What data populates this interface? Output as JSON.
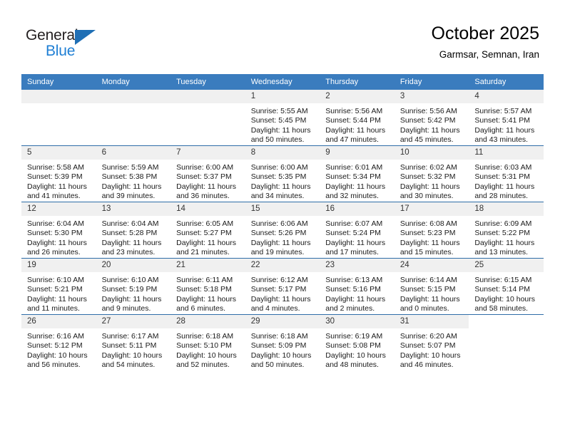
{
  "brand": {
    "name_top": "General",
    "name_bottom": "Blue",
    "triangle_icon": "triangle-icon",
    "color_dark": "#231f20",
    "color_blue": "#1f7fd4"
  },
  "header": {
    "title": "October 2025",
    "subtitle": "Garmsar, Semnan, Iran"
  },
  "colors": {
    "header_band": "#3a7cbe",
    "row_separator": "#2f6da8",
    "daynum_strip": "#f0f0f0",
    "text": "#1a1a1a"
  },
  "weekdays": [
    "Sunday",
    "Monday",
    "Tuesday",
    "Wednesday",
    "Thursday",
    "Friday",
    "Saturday"
  ],
  "weeks": [
    [
      {
        "day": "",
        "empty": true
      },
      {
        "day": "",
        "empty": true
      },
      {
        "day": "",
        "empty": true
      },
      {
        "day": "1",
        "sunrise": "Sunrise: 5:55 AM",
        "sunset": "Sunset: 5:45 PM",
        "daylight1": "Daylight: 11 hours",
        "daylight2": "and 50 minutes."
      },
      {
        "day": "2",
        "sunrise": "Sunrise: 5:56 AM",
        "sunset": "Sunset: 5:44 PM",
        "daylight1": "Daylight: 11 hours",
        "daylight2": "and 47 minutes."
      },
      {
        "day": "3",
        "sunrise": "Sunrise: 5:56 AM",
        "sunset": "Sunset: 5:42 PM",
        "daylight1": "Daylight: 11 hours",
        "daylight2": "and 45 minutes."
      },
      {
        "day": "4",
        "sunrise": "Sunrise: 5:57 AM",
        "sunset": "Sunset: 5:41 PM",
        "daylight1": "Daylight: 11 hours",
        "daylight2": "and 43 minutes."
      }
    ],
    [
      {
        "day": "5",
        "sunrise": "Sunrise: 5:58 AM",
        "sunset": "Sunset: 5:39 PM",
        "daylight1": "Daylight: 11 hours",
        "daylight2": "and 41 minutes."
      },
      {
        "day": "6",
        "sunrise": "Sunrise: 5:59 AM",
        "sunset": "Sunset: 5:38 PM",
        "daylight1": "Daylight: 11 hours",
        "daylight2": "and 39 minutes."
      },
      {
        "day": "7",
        "sunrise": "Sunrise: 6:00 AM",
        "sunset": "Sunset: 5:37 PM",
        "daylight1": "Daylight: 11 hours",
        "daylight2": "and 36 minutes."
      },
      {
        "day": "8",
        "sunrise": "Sunrise: 6:00 AM",
        "sunset": "Sunset: 5:35 PM",
        "daylight1": "Daylight: 11 hours",
        "daylight2": "and 34 minutes."
      },
      {
        "day": "9",
        "sunrise": "Sunrise: 6:01 AM",
        "sunset": "Sunset: 5:34 PM",
        "daylight1": "Daylight: 11 hours",
        "daylight2": "and 32 minutes."
      },
      {
        "day": "10",
        "sunrise": "Sunrise: 6:02 AM",
        "sunset": "Sunset: 5:32 PM",
        "daylight1": "Daylight: 11 hours",
        "daylight2": "and 30 minutes."
      },
      {
        "day": "11",
        "sunrise": "Sunrise: 6:03 AM",
        "sunset": "Sunset: 5:31 PM",
        "daylight1": "Daylight: 11 hours",
        "daylight2": "and 28 minutes."
      }
    ],
    [
      {
        "day": "12",
        "sunrise": "Sunrise: 6:04 AM",
        "sunset": "Sunset: 5:30 PM",
        "daylight1": "Daylight: 11 hours",
        "daylight2": "and 26 minutes."
      },
      {
        "day": "13",
        "sunrise": "Sunrise: 6:04 AM",
        "sunset": "Sunset: 5:28 PM",
        "daylight1": "Daylight: 11 hours",
        "daylight2": "and 23 minutes."
      },
      {
        "day": "14",
        "sunrise": "Sunrise: 6:05 AM",
        "sunset": "Sunset: 5:27 PM",
        "daylight1": "Daylight: 11 hours",
        "daylight2": "and 21 minutes."
      },
      {
        "day": "15",
        "sunrise": "Sunrise: 6:06 AM",
        "sunset": "Sunset: 5:26 PM",
        "daylight1": "Daylight: 11 hours",
        "daylight2": "and 19 minutes."
      },
      {
        "day": "16",
        "sunrise": "Sunrise: 6:07 AM",
        "sunset": "Sunset: 5:24 PM",
        "daylight1": "Daylight: 11 hours",
        "daylight2": "and 17 minutes."
      },
      {
        "day": "17",
        "sunrise": "Sunrise: 6:08 AM",
        "sunset": "Sunset: 5:23 PM",
        "daylight1": "Daylight: 11 hours",
        "daylight2": "and 15 minutes."
      },
      {
        "day": "18",
        "sunrise": "Sunrise: 6:09 AM",
        "sunset": "Sunset: 5:22 PM",
        "daylight1": "Daylight: 11 hours",
        "daylight2": "and 13 minutes."
      }
    ],
    [
      {
        "day": "19",
        "sunrise": "Sunrise: 6:10 AM",
        "sunset": "Sunset: 5:21 PM",
        "daylight1": "Daylight: 11 hours",
        "daylight2": "and 11 minutes."
      },
      {
        "day": "20",
        "sunrise": "Sunrise: 6:10 AM",
        "sunset": "Sunset: 5:19 PM",
        "daylight1": "Daylight: 11 hours",
        "daylight2": "and 9 minutes."
      },
      {
        "day": "21",
        "sunrise": "Sunrise: 6:11 AM",
        "sunset": "Sunset: 5:18 PM",
        "daylight1": "Daylight: 11 hours",
        "daylight2": "and 6 minutes."
      },
      {
        "day": "22",
        "sunrise": "Sunrise: 6:12 AM",
        "sunset": "Sunset: 5:17 PM",
        "daylight1": "Daylight: 11 hours",
        "daylight2": "and 4 minutes."
      },
      {
        "day": "23",
        "sunrise": "Sunrise: 6:13 AM",
        "sunset": "Sunset: 5:16 PM",
        "daylight1": "Daylight: 11 hours",
        "daylight2": "and 2 minutes."
      },
      {
        "day": "24",
        "sunrise": "Sunrise: 6:14 AM",
        "sunset": "Sunset: 5:15 PM",
        "daylight1": "Daylight: 11 hours",
        "daylight2": "and 0 minutes."
      },
      {
        "day": "25",
        "sunrise": "Sunrise: 6:15 AM",
        "sunset": "Sunset: 5:14 PM",
        "daylight1": "Daylight: 10 hours",
        "daylight2": "and 58 minutes."
      }
    ],
    [
      {
        "day": "26",
        "sunrise": "Sunrise: 6:16 AM",
        "sunset": "Sunset: 5:12 PM",
        "daylight1": "Daylight: 10 hours",
        "daylight2": "and 56 minutes."
      },
      {
        "day": "27",
        "sunrise": "Sunrise: 6:17 AM",
        "sunset": "Sunset: 5:11 PM",
        "daylight1": "Daylight: 10 hours",
        "daylight2": "and 54 minutes."
      },
      {
        "day": "28",
        "sunrise": "Sunrise: 6:18 AM",
        "sunset": "Sunset: 5:10 PM",
        "daylight1": "Daylight: 10 hours",
        "daylight2": "and 52 minutes."
      },
      {
        "day": "29",
        "sunrise": "Sunrise: 6:18 AM",
        "sunset": "Sunset: 5:09 PM",
        "daylight1": "Daylight: 10 hours",
        "daylight2": "and 50 minutes."
      },
      {
        "day": "30",
        "sunrise": "Sunrise: 6:19 AM",
        "sunset": "Sunset: 5:08 PM",
        "daylight1": "Daylight: 10 hours",
        "daylight2": "and 48 minutes."
      },
      {
        "day": "31",
        "sunrise": "Sunrise: 6:20 AM",
        "sunset": "Sunset: 5:07 PM",
        "daylight1": "Daylight: 10 hours",
        "daylight2": "and 46 minutes."
      },
      {
        "day": "",
        "blank": true
      }
    ]
  ]
}
